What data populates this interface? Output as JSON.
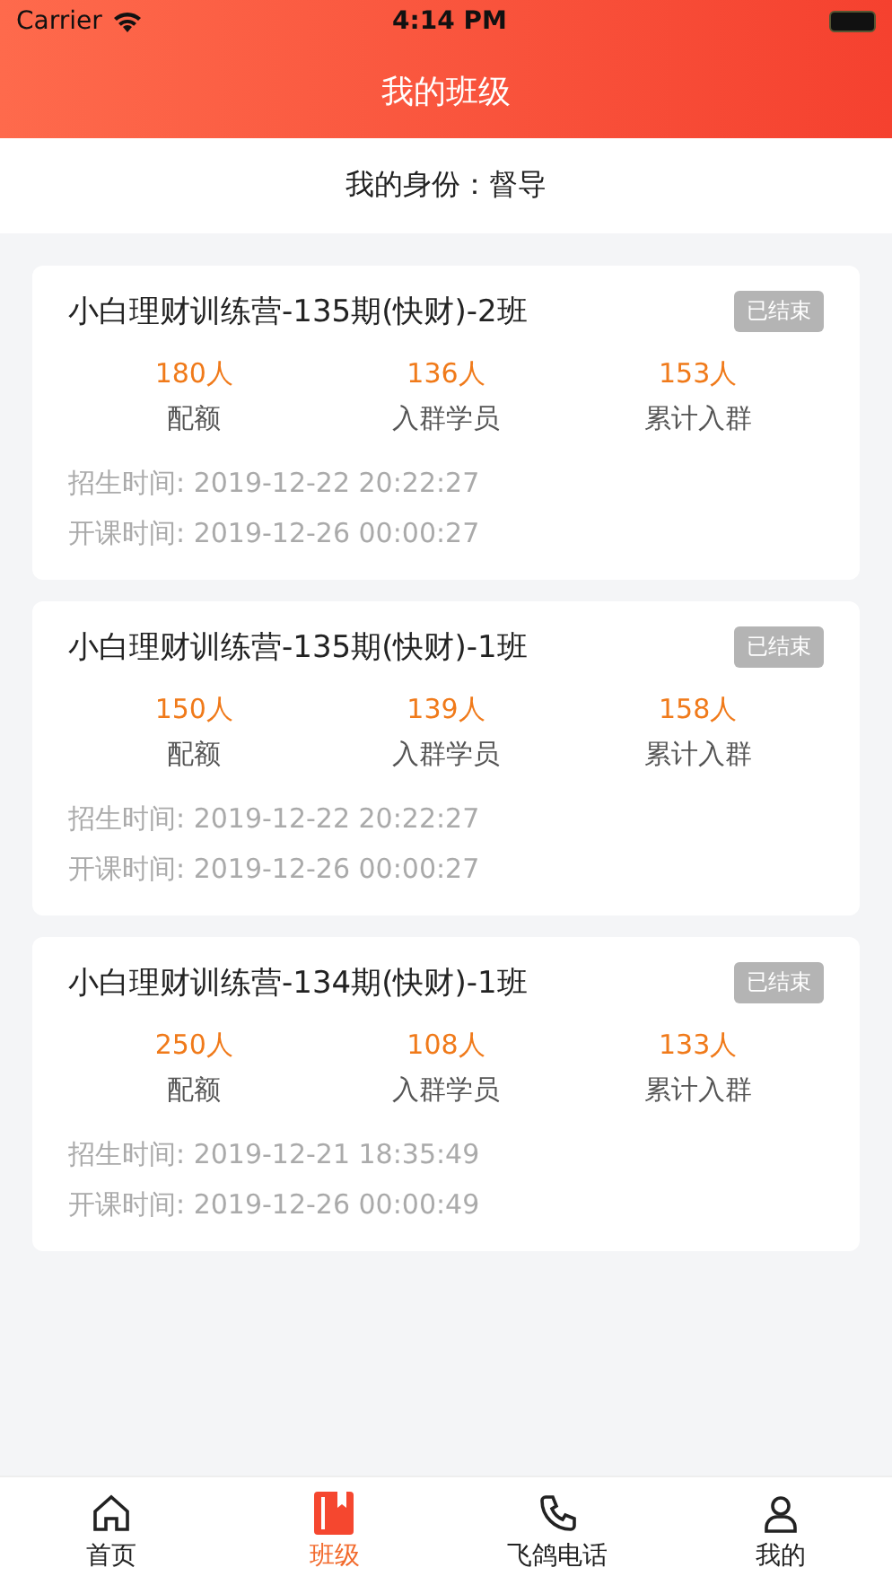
{
  "status_bar": {
    "carrier": "Carrier",
    "time": "4:14 PM"
  },
  "nav": {
    "title": "我的班级"
  },
  "identity": {
    "text": "我的身份：督导"
  },
  "classes": [
    {
      "title": "小白理财训练营-135期(快财)-2班",
      "status": "已结束",
      "stats": [
        {
          "value": "180人",
          "label": "配额"
        },
        {
          "value": "136人",
          "label": "入群学员"
        },
        {
          "value": "153人",
          "label": "累计入群"
        }
      ],
      "times": [
        "招生时间: 2019-12-22 20:22:27",
        "开课时间: 2019-12-26 00:00:27"
      ]
    },
    {
      "title": "小白理财训练营-135期(快财)-1班",
      "status": "已结束",
      "stats": [
        {
          "value": "150人",
          "label": "配额"
        },
        {
          "value": "139人",
          "label": "入群学员"
        },
        {
          "value": "158人",
          "label": "累计入群"
        }
      ],
      "times": [
        "招生时间: 2019-12-22 20:22:27",
        "开课时间: 2019-12-26 00:00:27"
      ]
    },
    {
      "title": "小白理财训练营-134期(快财)-1班",
      "status": "已结束",
      "stats": [
        {
          "value": "250人",
          "label": "配额"
        },
        {
          "value": "108人",
          "label": "入群学员"
        },
        {
          "value": "133人",
          "label": "累计入群"
        }
      ],
      "times": [
        "招生时间: 2019-12-21 18:35:49",
        "开课时间: 2019-12-26 00:00:49"
      ]
    }
  ],
  "tabs": [
    {
      "label": "首页",
      "kind": "home",
      "selected": false
    },
    {
      "label": "班级",
      "kind": "class",
      "selected": true
    },
    {
      "label": "飞鸽电话",
      "kind": "phone",
      "selected": false
    },
    {
      "label": "我的",
      "kind": "user",
      "selected": false
    }
  ]
}
